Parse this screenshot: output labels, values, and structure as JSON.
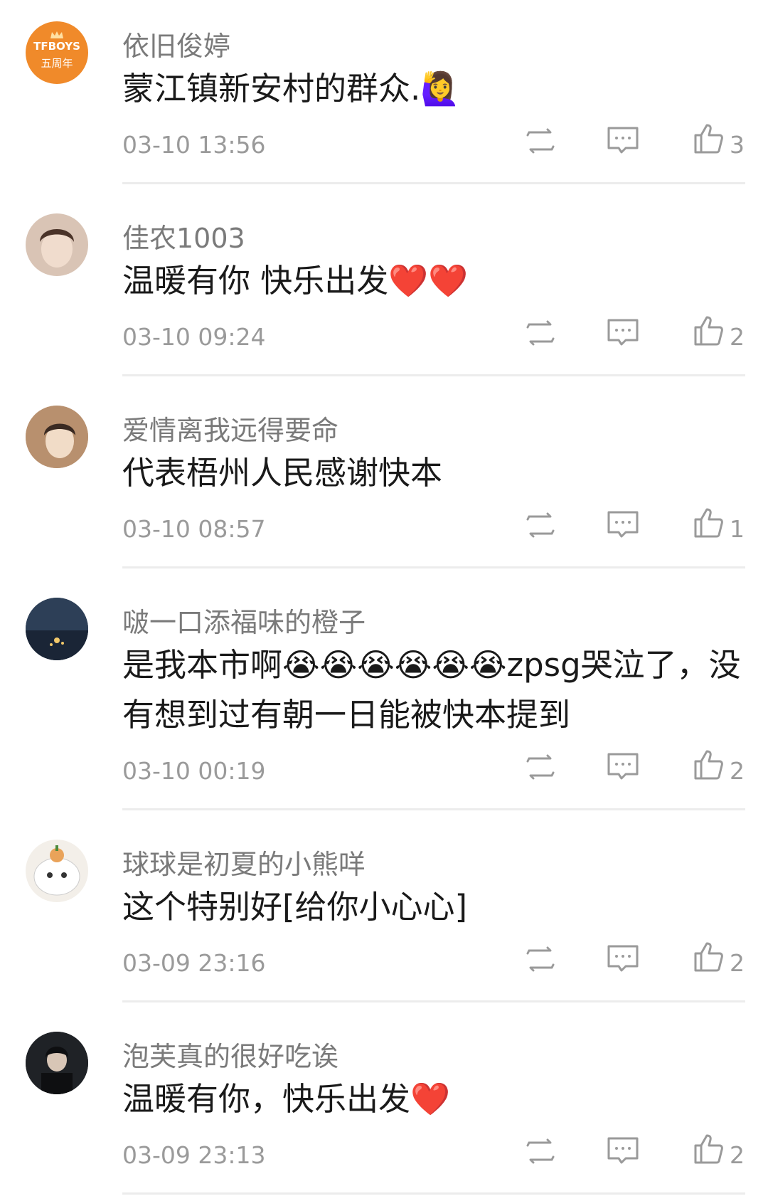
{
  "comments": [
    {
      "user": "依旧俊婷",
      "text": "蒙江镇新安村的群众.🙋‍♀️",
      "time": "03-10 13:56",
      "likes": "3",
      "avatar_text_1": "TFBOYS",
      "avatar_text_2": "五周年",
      "avatar_color": "#f08a2a"
    },
    {
      "user": "佳农1003",
      "text": "温暖有你 快乐出发❤️❤️",
      "time": "03-10 09:24",
      "likes": "2",
      "avatar_color": "#d9c4b5"
    },
    {
      "user": "爱情离我远得要命",
      "text": "代表梧州人民感谢快本",
      "time": "03-10 08:57",
      "likes": "1",
      "avatar_color": "#c9a68a"
    },
    {
      "user": "啵一口添福味的橙子",
      "text": "是我本市啊😭😭😭😭😭😭zpsg哭泣了，没有想到过有朝一日能被快本提到",
      "time": "03-10 00:19",
      "likes": "2",
      "avatar_color": "#2d3f57"
    },
    {
      "user": "球球是初夏的小熊咩",
      "text": "这个特别好[给你小心心]",
      "time": "03-09 23:16",
      "likes": "2",
      "avatar_color": "#f3efe9"
    },
    {
      "user": "泡芙真的很好吃诶",
      "text": "温暖有你，快乐出发❤️",
      "time": "03-09 23:13",
      "likes": "2",
      "avatar_color": "#1f2226"
    }
  ]
}
